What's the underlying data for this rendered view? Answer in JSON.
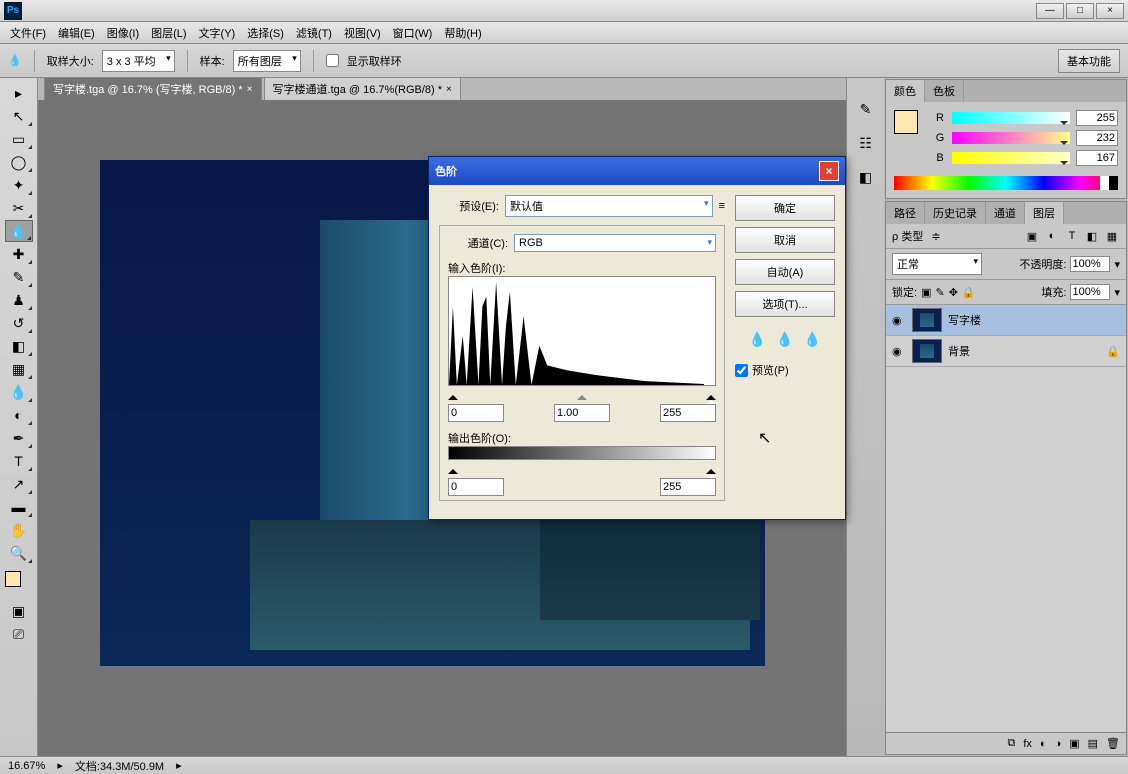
{
  "titlebar": {
    "logo": "Ps"
  },
  "menus": [
    "文件(F)",
    "编辑(E)",
    "图像(I)",
    "图层(L)",
    "文字(Y)",
    "选择(S)",
    "滤镜(T)",
    "视图(V)",
    "窗口(W)",
    "帮助(H)"
  ],
  "optbar": {
    "sample_size_label": "取样大小:",
    "sample_size_value": "3 x 3 平均",
    "sample_label": "样本:",
    "sample_value": "所有图层",
    "show_ring": "显示取样环",
    "basic": "基本功能"
  },
  "tabs": [
    {
      "label": "写字楼.tga @ 16.7% (写字楼, RGB/8) *"
    },
    {
      "label": "写字楼通道.tga @ 16.7%(RGB/8) *"
    }
  ],
  "statusbar": {
    "zoom": "16.67%",
    "doc": "文档:34.3M/50.9M"
  },
  "colorpanel": {
    "tabs": [
      "颜色",
      "色板"
    ],
    "r": "255",
    "g": "232",
    "b": "167"
  },
  "layerspanel": {
    "tabs": [
      "路径",
      "历史记录",
      "通道",
      "图层"
    ],
    "filter_label": "ρ 类型",
    "blend": "正常",
    "opacity_label": "不透明度:",
    "opacity": "100%",
    "lock_label": "锁定:",
    "fill_label": "填充:",
    "fill": "100%",
    "layers": [
      {
        "name": "写字楼",
        "sel": true
      },
      {
        "name": "背景",
        "locked": true
      }
    ]
  },
  "dialog": {
    "title": "色阶",
    "preset_label": "预设(E):",
    "preset_value": "默认值",
    "channel_label": "通道(C):",
    "channel_value": "RGB",
    "input_label": "输入色阶(I):",
    "in_low": "0",
    "in_mid": "1.00",
    "in_high": "255",
    "output_label": "输出色阶(O):",
    "out_low": "0",
    "out_high": "255",
    "ok": "确定",
    "cancel": "取消",
    "auto": "自动(A)",
    "options": "选项(T)...",
    "preview": "预览(P)"
  }
}
